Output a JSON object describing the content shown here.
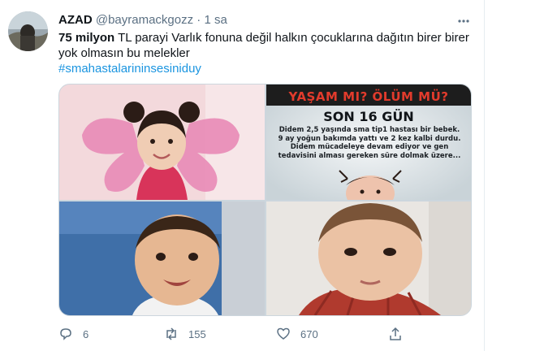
{
  "tweet": {
    "author_name": "AZAD",
    "handle": "@bayramackgozz",
    "separator": "·",
    "time": "1 sa",
    "text_bold": "75 milyon",
    "text_rest": " TL parayi Varlık fonuna değil halkın çocuklarına dağıtın birer birer yok olmasın bu melekler",
    "hashtag": "#smahastalarininsesiniduy"
  },
  "poster": {
    "title": "YAŞAM MI?  ÖLÜM MÜ?",
    "subtitle": "SON 16 GÜN",
    "lines": [
      "Didem 2,5 yaşında sma tip1 hastası bir bebek.",
      "9 ay yoğun bakımda yattı ve 2 kez kalbi durdu.",
      "Didem mücadeleye devam ediyor ve gen",
      "tedavisini alması gereken süre dolmak üzere..."
    ]
  },
  "actions": {
    "replies": "6",
    "retweets": "155",
    "likes": "670"
  },
  "colors": {
    "accent": "#1b95e0",
    "secondary_text": "#5b7083",
    "poster_red": "#e23b2c"
  }
}
